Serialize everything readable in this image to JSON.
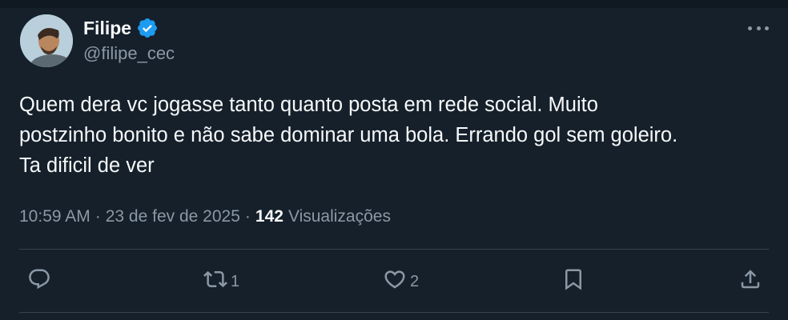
{
  "author": {
    "name": "Filipe",
    "handle": "@filipe_cec"
  },
  "tweet": {
    "text": "Quem dera vc jogasse tanto quanto posta em rede social. Muito\npostzinho bonito e não sabe dominar uma bola. Errando gol sem goleiro.\nTa dificil de ver"
  },
  "meta": {
    "time": "10:59 AM",
    "separator": "·",
    "date": "23 de fev de 2025",
    "separator2": "·",
    "views_count": "142",
    "views_label": "Visualizações"
  },
  "actions": {
    "reply_count": "",
    "retweet_count": "1",
    "like_count": "2"
  },
  "colors": {
    "background": "#15202b",
    "text": "#f7f9f9",
    "secondary": "#8b98a5",
    "verified": "#1d9bf0",
    "divider": "#38444d"
  },
  "icons": [
    "verified-badge-icon",
    "more-icon",
    "reply-icon",
    "retweet-icon",
    "like-icon",
    "bookmark-icon",
    "share-icon"
  ]
}
